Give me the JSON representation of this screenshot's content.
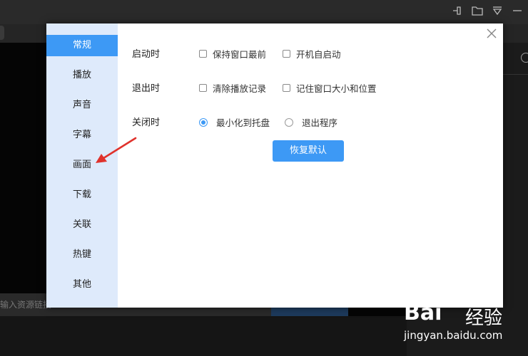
{
  "background": {
    "input_placeholder": "输入资源链接"
  },
  "dialog": {
    "nav_items": [
      {
        "label": "常规",
        "active": true
      },
      {
        "label": "播放",
        "active": false
      },
      {
        "label": "声音",
        "active": false
      },
      {
        "label": "字幕",
        "active": false
      },
      {
        "label": "画面",
        "active": false
      },
      {
        "label": "下载",
        "active": false
      },
      {
        "label": "关联",
        "active": false
      },
      {
        "label": "热键",
        "active": false
      },
      {
        "label": "其他",
        "active": false
      }
    ],
    "startup": {
      "label": "启动时",
      "options": [
        {
          "label": "保持窗口最前",
          "checked": false
        },
        {
          "label": "开机自启动",
          "checked": false
        }
      ]
    },
    "exit": {
      "label": "退出时",
      "options": [
        {
          "label": "清除播放记录",
          "checked": false
        },
        {
          "label": "记住窗口大小和位置",
          "checked": false
        }
      ]
    },
    "close": {
      "label": "关闭时",
      "options": [
        {
          "label": "最小化到托盘",
          "selected": true
        },
        {
          "label": "退出程序",
          "selected": false
        }
      ]
    },
    "reset_label": "恢复默认"
  },
  "watermark": {
    "logo": "Bai",
    "brand": "经验",
    "url": "jingyan.baidu.com"
  },
  "colors": {
    "accent": "#3d99f5",
    "sidebar": "#deeafb",
    "arrow": "#e0322c"
  }
}
